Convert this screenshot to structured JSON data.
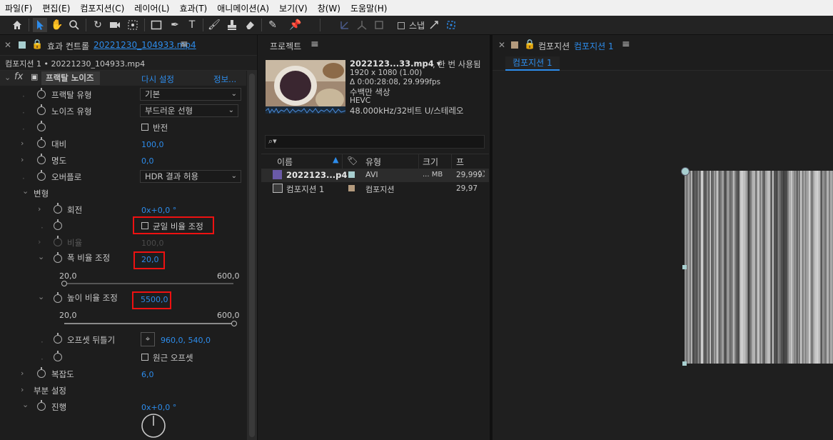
{
  "menu": [
    "파일(F)",
    "편집(E)",
    "컴포지션(C)",
    "레이어(L)",
    "효과(T)",
    "애니메이션(A)",
    "보기(V)",
    "창(W)",
    "도움말(H)"
  ],
  "toolbar": {
    "snap_label": "스냅"
  },
  "effects_panel": {
    "tab_label": "효과 컨트롤",
    "tab_file": "20221230_104933.mp4",
    "breadcrumb": "컴포지션 1 • 20221230_104933.mp4",
    "effect_name": "프랙탈 노이즈",
    "reset_label": "다시 설정",
    "info_label": "정보...",
    "rows": {
      "fractal_type": {
        "label": "프랙탈 유형",
        "value": "기본"
      },
      "noise_type": {
        "label": "노이즈 유형",
        "value": "부드러운 선형"
      },
      "invert": {
        "label": "반전"
      },
      "contrast": {
        "label": "대비",
        "value": "100,0"
      },
      "brightness": {
        "label": "명도",
        "value": "0,0"
      },
      "overflow": {
        "label": "오버플로",
        "value": "HDR 결과 허용"
      },
      "transform": {
        "label": "변형"
      },
      "rotation": {
        "label": "회전",
        "value": "0x+0,0 °"
      },
      "uniform_scale": {
        "label": "균일 비율 조정"
      },
      "scale": {
        "label": "비율",
        "value": "100,0"
      },
      "scale_width": {
        "label": "폭 비율 조정",
        "value": "20,0",
        "min": "20,0",
        "max": "600,0"
      },
      "scale_height": {
        "label": "높이 비율 조정",
        "value": "5500,0",
        "min": "20,0",
        "max": "600,0"
      },
      "offset": {
        "label": "오프셋 뒤틀기",
        "value": "960,0, 540,0"
      },
      "perspective": {
        "label": "원근 오프셋"
      },
      "complexity": {
        "label": "복잡도",
        "value": "6,0"
      },
      "sub_settings": {
        "label": "부분 설정"
      },
      "evolution": {
        "label": "진행",
        "value": "0x+0,0 °"
      }
    }
  },
  "project_panel": {
    "tab_label": "프로젝트",
    "file_title": "2022123...33.mp4 ▾",
    "usage": ", 한 번 사용됨",
    "resolution": "1920 x 1080 (1.00)",
    "duration": "Δ 0:00:28:08, 29.999fps",
    "color": "수백만 색상",
    "codec": "HEVC",
    "audio": "48.000kHz/32비트 U/스테레오",
    "search_placeholder": "",
    "columns": {
      "name": "이름",
      "type": "유형",
      "size": "크기",
      "fps": "프"
    },
    "items": [
      {
        "name": "2022123...p4",
        "type": "AVI",
        "size": "... MB",
        "fps": "29,999",
        "swatch": "#a8cfd0"
      },
      {
        "name": "컴포지션 1",
        "type": "컴포지션",
        "size": "",
        "fps": "29,97",
        "swatch": "#b39a7d"
      }
    ]
  },
  "comp_panel": {
    "tab_prefix": "컴포지션",
    "tab_name": "컴포지션 1",
    "subtab": "컴포지션 1"
  }
}
